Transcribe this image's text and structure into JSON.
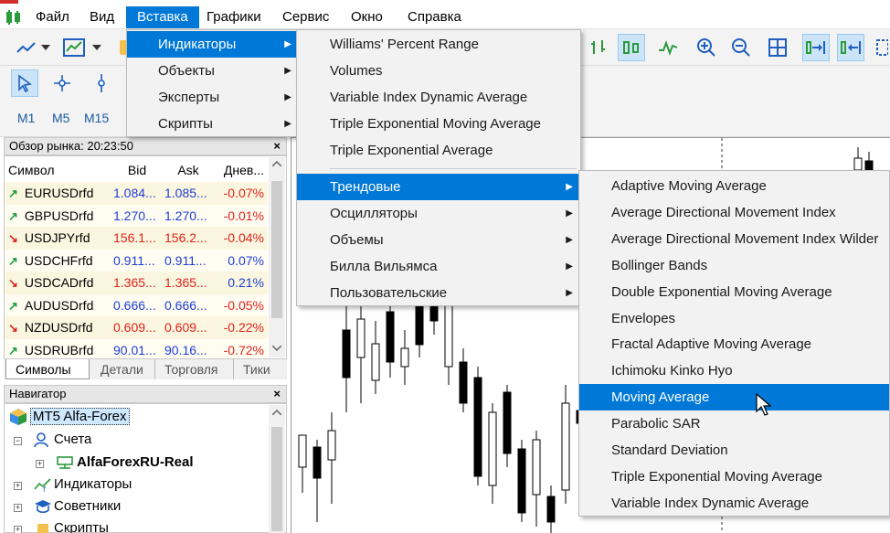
{
  "menubar": {
    "items": [
      "Файл",
      "Вид",
      "Вставка",
      "Графики",
      "Сервис",
      "Окно",
      "Справка"
    ],
    "active": "Вставка"
  },
  "timeframes": [
    "M1",
    "M5",
    "M15"
  ],
  "market_watch": {
    "title": "Обзор рынка: 20:23:50",
    "columns": [
      "Символ",
      "Bid",
      "Ask",
      "Днев..."
    ],
    "rows": [
      {
        "symbol": "EURUSDrfd",
        "bid": "1.084...",
        "ask": "1.085...",
        "change": "-0.07%",
        "dir": "up",
        "bid_color": "blue",
        "ask_color": "blue",
        "chg_color": "red"
      },
      {
        "symbol": "GBPUSDrfd",
        "bid": "1.270...",
        "ask": "1.270...",
        "change": "-0.01%",
        "dir": "up",
        "bid_color": "blue",
        "ask_color": "blue",
        "chg_color": "red"
      },
      {
        "symbol": "USDJPYrfd",
        "bid": "156.1...",
        "ask": "156.2...",
        "change": "-0.04%",
        "dir": "down",
        "bid_color": "red",
        "ask_color": "red",
        "chg_color": "red"
      },
      {
        "symbol": "USDCHFrfd",
        "bid": "0.911...",
        "ask": "0.911...",
        "change": "0.07%",
        "dir": "up",
        "bid_color": "blue",
        "ask_color": "blue",
        "chg_color": "blue"
      },
      {
        "symbol": "USDCADrfd",
        "bid": "1.365...",
        "ask": "1.365...",
        "change": "0.21%",
        "dir": "down",
        "bid_color": "red",
        "ask_color": "red",
        "chg_color": "blue"
      },
      {
        "symbol": "AUDUSDrfd",
        "bid": "0.666...",
        "ask": "0.666...",
        "change": "-0.05%",
        "dir": "up",
        "bid_color": "blue",
        "ask_color": "blue",
        "chg_color": "red"
      },
      {
        "symbol": "NZDUSDrfd",
        "bid": "0.609...",
        "ask": "0.609...",
        "change": "-0.22%",
        "dir": "down",
        "bid_color": "red",
        "ask_color": "red",
        "chg_color": "red"
      },
      {
        "symbol": "USDRUBrfd",
        "bid": "90.01...",
        "ask": "90.16...",
        "change": "-0.72%",
        "dir": "up",
        "bid_color": "blue",
        "ask_color": "blue",
        "chg_color": "red"
      }
    ],
    "tabs": [
      "Символы",
      "Детали",
      "Торговля",
      "Тики"
    ]
  },
  "navigator": {
    "title": "Навигатор",
    "items": [
      "MT5 Alfa-Forex",
      "Счета",
      "AlfaForexRU-Real",
      "Индикаторы",
      "Советники",
      "Скрипты"
    ]
  },
  "insert_menu": {
    "items": [
      "Индикаторы",
      "Объекты",
      "Эксперты",
      "Скрипты"
    ]
  },
  "indicators_menu": {
    "recent": [
      "Williams' Percent Range",
      "Volumes",
      "Variable Index Dynamic Average",
      "Triple Exponential Moving Average",
      "Triple Exponential Average"
    ],
    "groups": [
      "Трендовые",
      "Осцилляторы",
      "Объемы",
      "Билла Вильямса",
      "Пользовательские"
    ]
  },
  "trend_menu": {
    "items": [
      "Adaptive Moving Average",
      "Average Directional Movement Index",
      "Average Directional Movement Index Wilder",
      "Bollinger Bands",
      "Double Exponential Moving Average",
      "Envelopes",
      "Fractal Adaptive Moving Average",
      "Ichimoku Kinko Hyo",
      "Moving Average",
      "Parabolic SAR",
      "Standard Deviation",
      "Triple Exponential Moving Average",
      "Variable Index Dynamic Average"
    ],
    "highlighted": "Moving Average"
  },
  "colors": {
    "accent": "#0078d7",
    "up": "#20a040",
    "down": "#dd2222",
    "bid_blue": "#1f3dd6",
    "bid_red": "#e0221d"
  }
}
